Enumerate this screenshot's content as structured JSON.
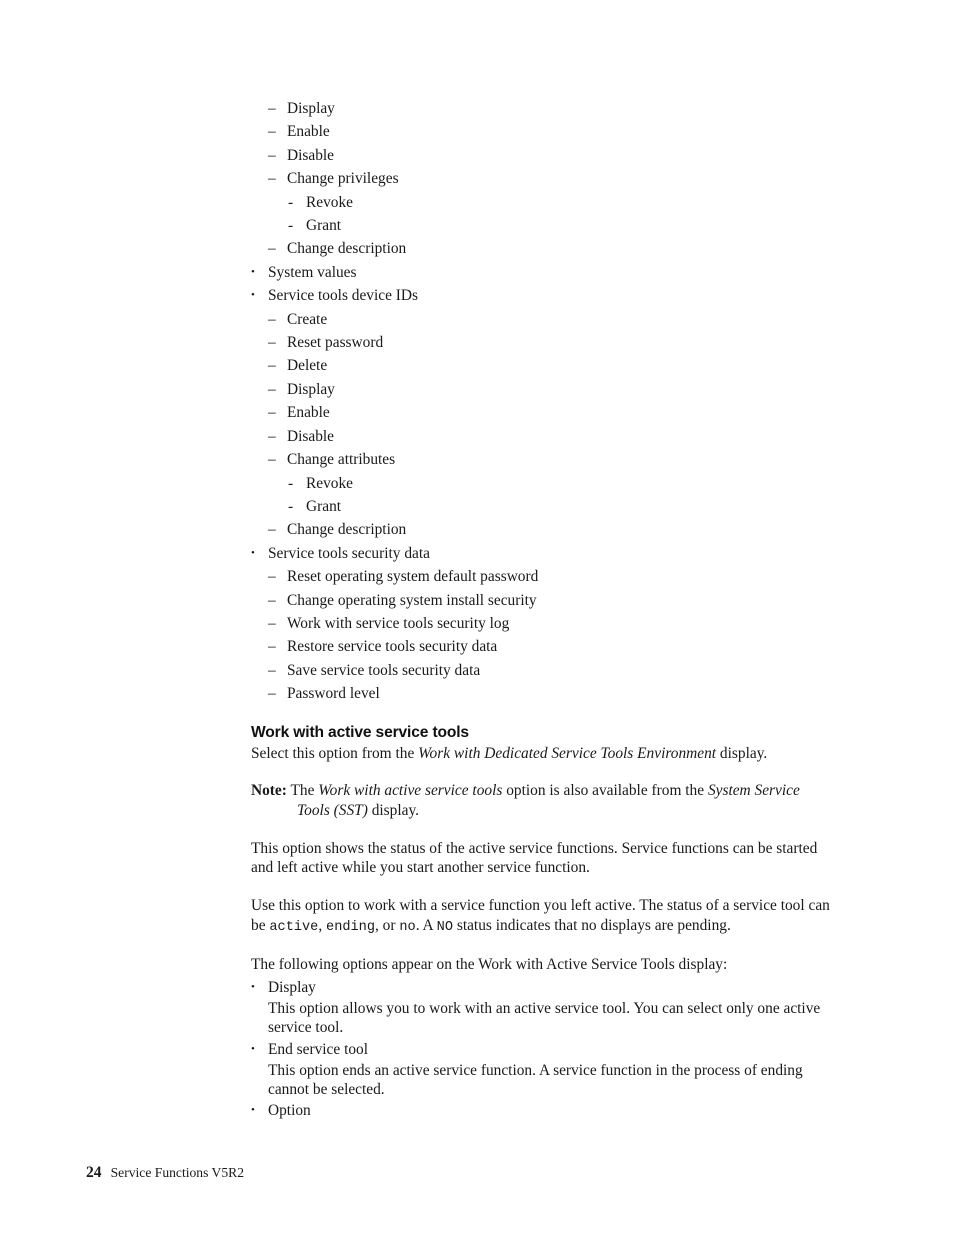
{
  "page": {
    "number": "24",
    "document_title": "Service Functions V5R2"
  },
  "outline": {
    "items": [
      {
        "level": 2,
        "marker": "–",
        "label": "Display"
      },
      {
        "level": 2,
        "marker": "–",
        "label": "Enable"
      },
      {
        "level": 2,
        "marker": "–",
        "label": "Disable"
      },
      {
        "level": 2,
        "marker": "–",
        "label": "Change privileges"
      },
      {
        "level": 3,
        "marker": "-",
        "label": "Revoke"
      },
      {
        "level": 3,
        "marker": "-",
        "label": "Grant"
      },
      {
        "level": 2,
        "marker": "–",
        "label": "Change description"
      },
      {
        "level": 1,
        "marker": "•",
        "label": "System values"
      },
      {
        "level": 1,
        "marker": "•",
        "label": "Service tools device IDs"
      },
      {
        "level": 2,
        "marker": "–",
        "label": "Create"
      },
      {
        "level": 2,
        "marker": "–",
        "label": "Reset password"
      },
      {
        "level": 2,
        "marker": "–",
        "label": "Delete"
      },
      {
        "level": 2,
        "marker": "–",
        "label": "Display"
      },
      {
        "level": 2,
        "marker": "–",
        "label": "Enable"
      },
      {
        "level": 2,
        "marker": "–",
        "label": "Disable"
      },
      {
        "level": 2,
        "marker": "–",
        "label": "Change attributes"
      },
      {
        "level": 3,
        "marker": "-",
        "label": "Revoke"
      },
      {
        "level": 3,
        "marker": "-",
        "label": "Grant"
      },
      {
        "level": 2,
        "marker": "–",
        "label": "Change description"
      },
      {
        "level": 1,
        "marker": "•",
        "label": "Service tools security data"
      },
      {
        "level": 2,
        "marker": "–",
        "label": "Reset operating system default password"
      },
      {
        "level": 2,
        "marker": "–",
        "label": "Change operating system install security"
      },
      {
        "level": 2,
        "marker": "–",
        "label": "Work with service tools security log"
      },
      {
        "level": 2,
        "marker": "–",
        "label": "Restore service tools security data"
      },
      {
        "level": 2,
        "marker": "–",
        "label": "Save service tools security data"
      },
      {
        "level": 2,
        "marker": "–",
        "label": "Password level"
      }
    ]
  },
  "section": {
    "heading": "Work with active service tools",
    "intro": {
      "before": "Select this option from the ",
      "italic": "Work with Dedicated Service Tools Environment",
      "after": " display."
    },
    "note": {
      "label": "Note:",
      "text_1": " The ",
      "italic_1": "Work with active service tools",
      "text_2": " option is also available from the ",
      "italic_2": "System Service Tools (SST)",
      "text_3": " display."
    },
    "paragraph_1": "This option shows the status of the active service functions. Service functions can be started and left active while you start another service function.",
    "paragraph_2": {
      "text_1": "Use this option to work with a service function you left active. The status of a service tool can be ",
      "mono_1": "active",
      "text_2": ", ",
      "mono_2": "ending",
      "text_3": ", or ",
      "mono_3": "no",
      "text_4": ". A ",
      "mono_4": "NO",
      "text_5": " status indicates that no displays are pending."
    },
    "options_intro": "The following options appear on the Work with Active Service Tools display:",
    "options": [
      {
        "marker": "•",
        "label": "Display",
        "body": "This option allows you to work with an active service tool. You can select only one active service tool."
      },
      {
        "marker": "•",
        "label": "End service tool",
        "body": "This option ends an active service function. A service function in the process of ending cannot be selected."
      },
      {
        "marker": "•",
        "label": "Option",
        "body": ""
      }
    ]
  }
}
